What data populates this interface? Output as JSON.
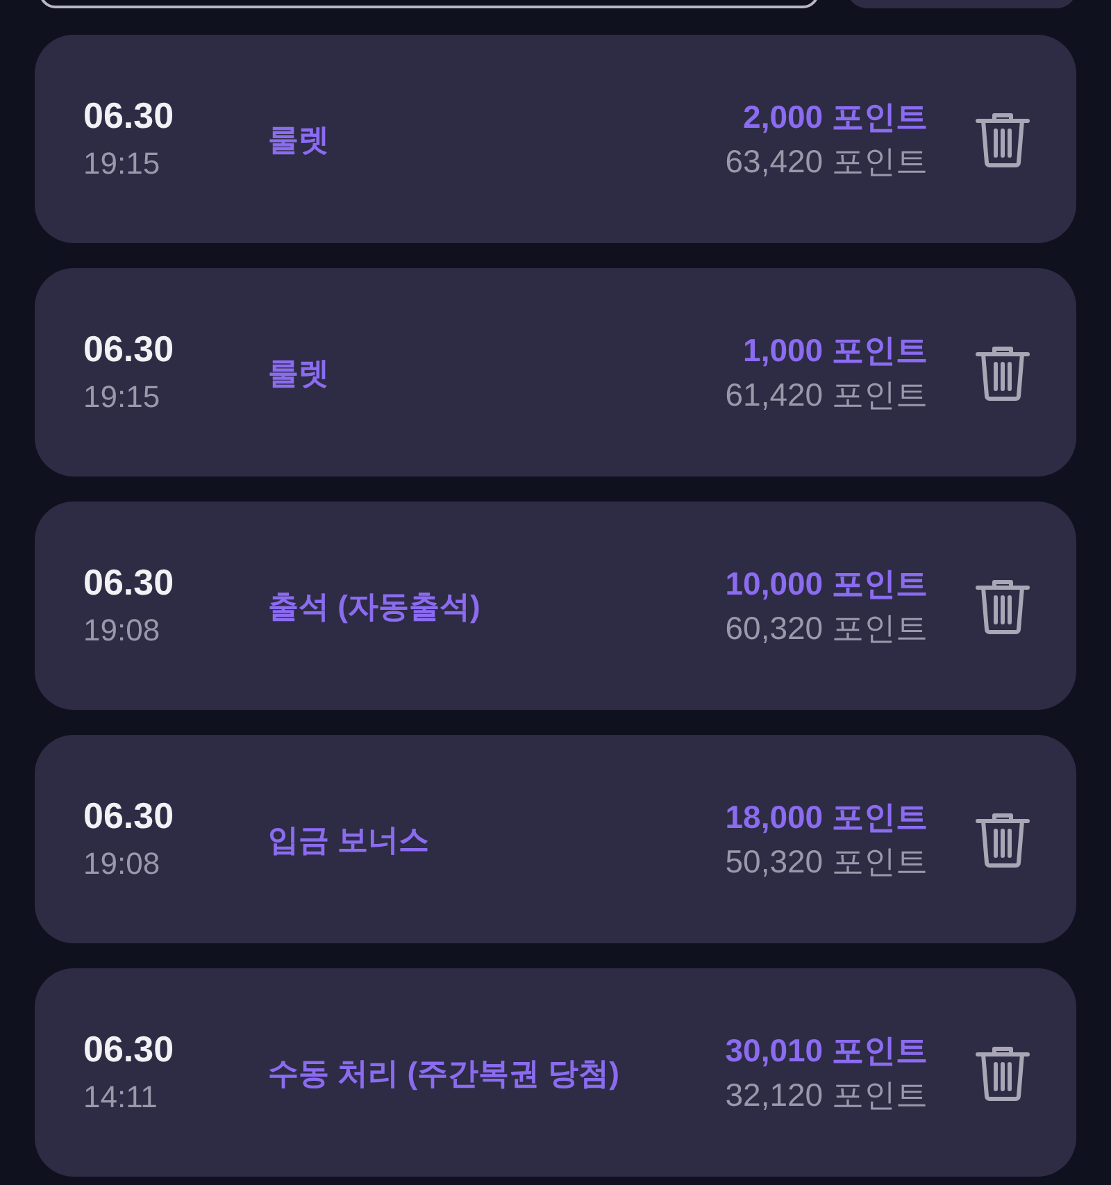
{
  "entries": [
    {
      "date": "06.30",
      "time": "19:15",
      "title": "룰렛",
      "amount": "2,000 포인트",
      "balance": "63,420 포인트"
    },
    {
      "date": "06.30",
      "time": "19:15",
      "title": "룰렛",
      "amount": "1,000 포인트",
      "balance": "61,420 포인트"
    },
    {
      "date": "06.30",
      "time": "19:08",
      "title": "출석 (자동출석)",
      "amount": "10,000 포인트",
      "balance": "60,320 포인트"
    },
    {
      "date": "06.30",
      "time": "19:08",
      "title": "입금 보너스",
      "amount": "18,000 포인트",
      "balance": "50,320 포인트"
    },
    {
      "date": "06.30",
      "time": "14:11",
      "title": "수동 처리 (주간복권 당첨)",
      "amount": "30,010 포인트",
      "balance": "32,120 포인트"
    }
  ]
}
